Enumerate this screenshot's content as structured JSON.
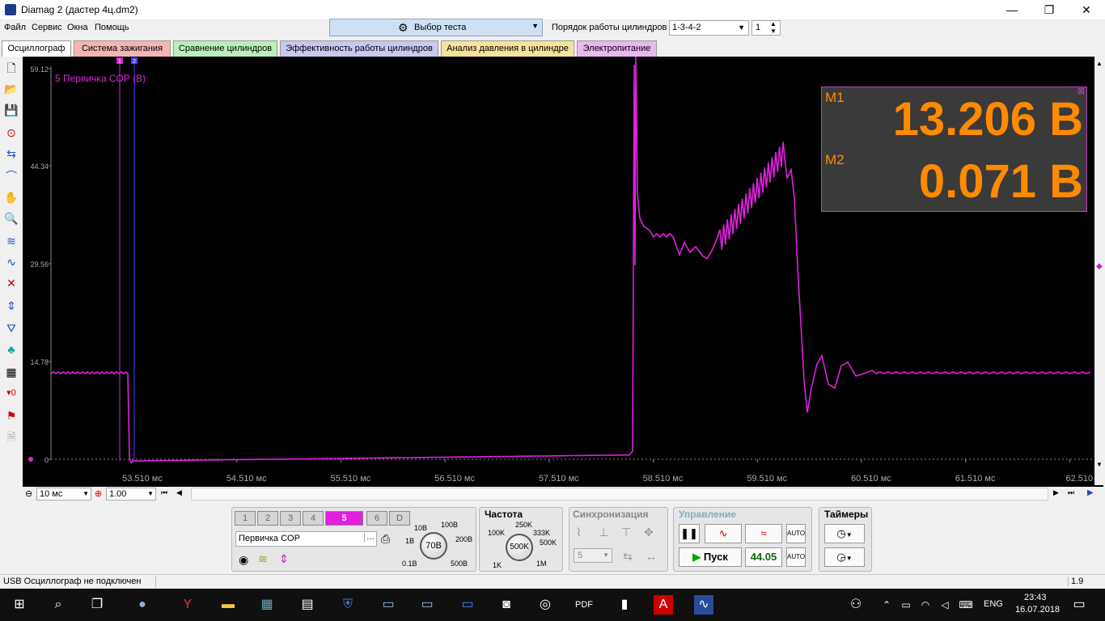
{
  "window": {
    "title": "Diamag 2 (дастер 4ц.dm2)",
    "minimize": "—",
    "maximize": "❐",
    "close": "✕"
  },
  "menu": [
    "Файл",
    "Сервис",
    "Окна",
    "Помощь"
  ],
  "test_select": {
    "label": "Выбор теста"
  },
  "cylinder_order": {
    "label": "Порядок работы цилиндров",
    "value": "1-3-4-2",
    "cylinder": "1"
  },
  "tabs": [
    {
      "label": "Осциллограф",
      "color": "#ffffff"
    },
    {
      "label": "Система зажигания",
      "color": "#f6b5b5"
    },
    {
      "label": "Сравнение цилиндров",
      "color": "#b9f0b9"
    },
    {
      "label": "Эффективность работы цилиндров",
      "color": "#c8c8f0"
    },
    {
      "label": "Анализ давления в цилиндре",
      "color": "#f5e39a"
    },
    {
      "label": "Электропитание",
      "color": "#e8b8f0"
    }
  ],
  "plot": {
    "channel_label": "5 Первичка COP (В)",
    "trace_color": "#e020e0",
    "marker1": "1",
    "marker2": "2",
    "y_ticks": [
      "59.12",
      "44.34",
      "29.56",
      "14.78",
      "0"
    ],
    "x_ticks": [
      "53.510 мс",
      "54.510 мс",
      "55.510 мс",
      "56.510 мс",
      "57.510 мс",
      "58.510 мс",
      "59.510 мс",
      "60.510 мс",
      "61.510 мс",
      "62.510"
    ]
  },
  "measure": {
    "m1_label": "M1",
    "m1_value": "13.206 В",
    "m2_label": "M2",
    "m2_value": "0.071 В"
  },
  "timebase": {
    "value": "10 мс",
    "zoom": "1.00"
  },
  "channels": {
    "buttons": [
      "1",
      "2",
      "3",
      "4",
      "5",
      "6",
      "D"
    ],
    "active": "5",
    "name": "Первичка COP",
    "range_value": "70В",
    "range_labels": [
      "10В",
      "100В",
      "1В",
      "200В",
      "0.1В",
      "500В"
    ]
  },
  "frequency": {
    "title": "Частота",
    "value": "500K",
    "labels": [
      "250K",
      "100K",
      "333K",
      "500K",
      "1K",
      "1M"
    ]
  },
  "sync": {
    "title": "Синхронизация",
    "channel": "5"
  },
  "control": {
    "title": "Управление",
    "start": "Пуск",
    "rate": "44.05"
  },
  "timers": {
    "title": "Таймеры"
  },
  "status": {
    "text": "USB Осциллограф не подключен",
    "version": "1.9"
  },
  "taskbar": {
    "lang": "ENG",
    "time": "23:43",
    "date": "16.07.2018"
  }
}
